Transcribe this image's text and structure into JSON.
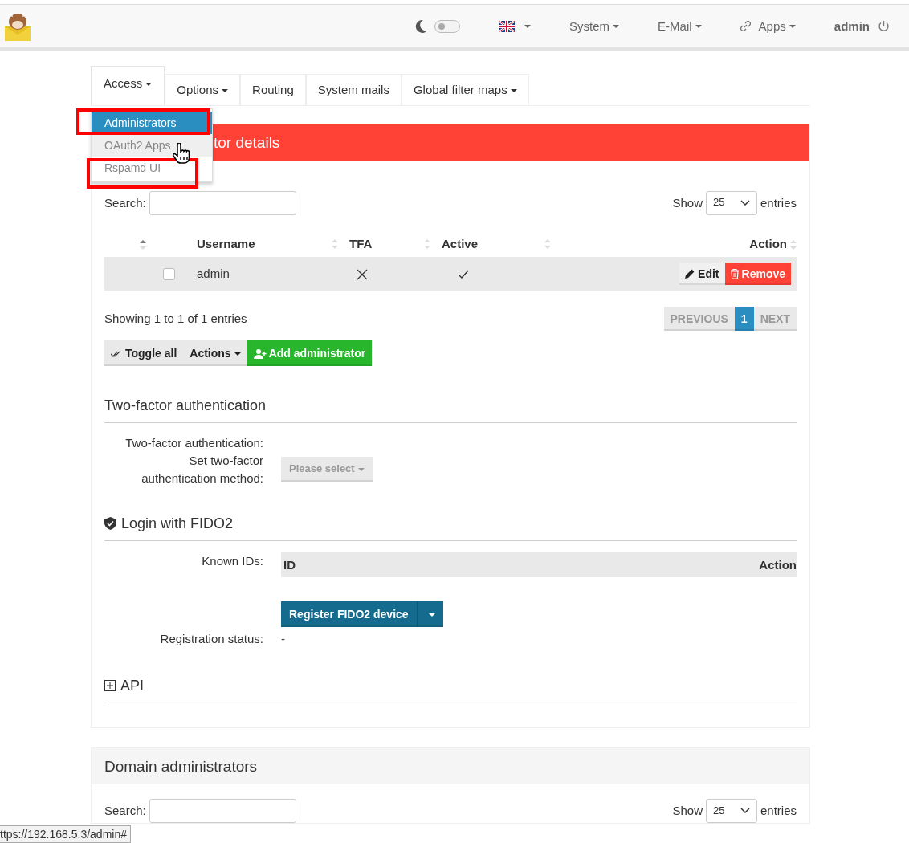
{
  "navbar": {
    "theme_toggle": {
      "on": false
    },
    "menus": [
      {
        "label": "System",
        "kind": "plain"
      },
      {
        "label": "E-Mail",
        "kind": "plain"
      },
      {
        "label": "Apps",
        "kind": "with_icon"
      }
    ],
    "user": "admin"
  },
  "tabs": [
    {
      "label": "Access",
      "dropdown": true,
      "selected": true
    },
    {
      "label": "Options",
      "dropdown": true,
      "selected": false
    },
    {
      "label": "Routing",
      "dropdown": false,
      "selected": false
    },
    {
      "label": "System mails",
      "dropdown": false,
      "selected": false
    },
    {
      "label": "Global filter maps",
      "dropdown": true,
      "selected": false
    }
  ],
  "dropdown_menu": [
    {
      "label": "Administrators",
      "selected": true,
      "hovered": false,
      "annotated": true
    },
    {
      "label": "OAuth2 Apps",
      "selected": false,
      "hovered": true,
      "annotated": false
    },
    {
      "label": "Rspamd UI",
      "selected": false,
      "hovered": false,
      "annotated": true
    }
  ],
  "admin_card": {
    "title": "tor details",
    "search_label": "Search:",
    "show_label": "Show",
    "page_size": "25",
    "entries_label": "entries",
    "columns": [
      {
        "sorted": true
      },
      {
        "label": "Username",
        "sorted": false
      },
      {
        "label": "TFA",
        "sorted": false
      },
      {
        "label": "Active",
        "sorted": false
      },
      {
        "label": "Action",
        "sorted": false
      }
    ],
    "rows": [
      {
        "checked": false,
        "username": "admin",
        "tfa": false,
        "active": true,
        "actions": [
          {
            "label": "Edit",
            "kind": "edit"
          },
          {
            "label": "Remove",
            "kind": "remove"
          }
        ]
      }
    ],
    "info": "Showing 1 to 1 of 1 entries",
    "pagination": [
      {
        "label": "PREVIOUS",
        "selected": false,
        "disabled": true
      },
      {
        "label": "1",
        "selected": true,
        "disabled": false
      },
      {
        "label": "NEXT",
        "selected": false,
        "disabled": true
      }
    ],
    "buttons": [
      {
        "label": "Toggle all",
        "kind": "toggle"
      },
      {
        "label": "Actions",
        "kind": "dropdown"
      },
      {
        "label": "Add administrator",
        "kind": "add"
      }
    ]
  },
  "tfa": {
    "title": "Two-factor authentication",
    "rows": [
      {
        "label": "Two-factor authentication:"
      },
      {
        "label": "Set two-factor authentication method:",
        "select": "Please select",
        "disabled": true
      }
    ]
  },
  "fido": {
    "title": "Login with FIDO2",
    "known_ids_label": "Known IDs:",
    "columns": [
      "ID",
      "Action"
    ],
    "register_button": "Register FIDO2 device",
    "status_label": "Registration status:",
    "status_value": "-"
  },
  "api": {
    "title": "API",
    "expanded": false
  },
  "domain_card": {
    "title": "Domain administrators",
    "search_label": "Search:",
    "show_label": "Show",
    "page_size": "25",
    "entries_label": "entries"
  },
  "status_url": "ttps://192.168.5.3/admin#"
}
